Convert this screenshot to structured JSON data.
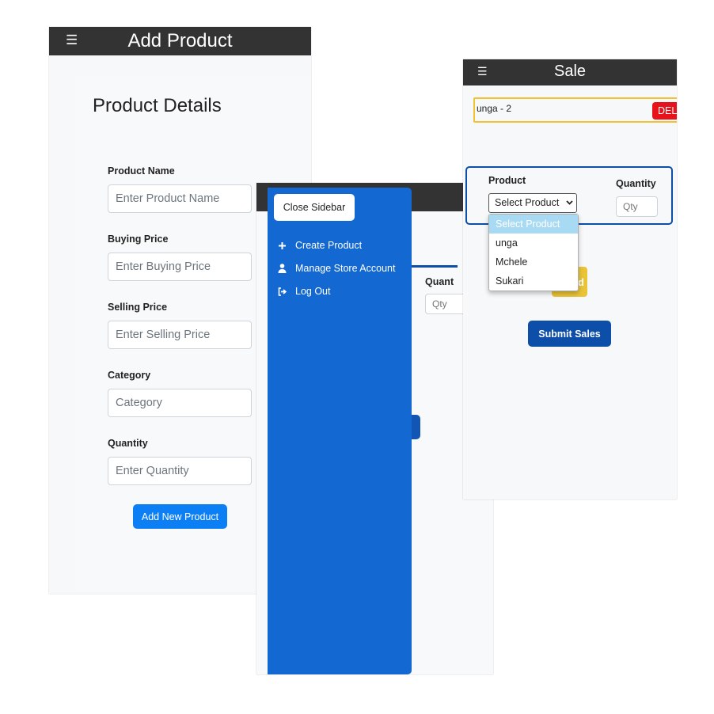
{
  "add_product": {
    "title": "Add Product",
    "menu_icon": "☰",
    "heading": "Product Details",
    "fields": [
      {
        "label": "Product Name",
        "placeholder": "Enter Product Name"
      },
      {
        "label": "Buying Price",
        "placeholder": "Enter Buying Price"
      },
      {
        "label": "Selling Price",
        "placeholder": "Enter Selling Price"
      },
      {
        "label": "Category",
        "placeholder": "Category"
      },
      {
        "label": "Quantity",
        "placeholder": "Enter Quantity"
      }
    ],
    "submit_label": "Add New Product"
  },
  "sidebar_screen": {
    "close_label": "Close Sidebar",
    "items": [
      {
        "label": "Create Product",
        "icon": "plus-icon"
      },
      {
        "label": "Manage Store Account",
        "icon": "user-icon"
      },
      {
        "label": "Log Out",
        "icon": "logout-icon"
      }
    ],
    "quantity_label": "Quant",
    "qty_placeholder": "Qty"
  },
  "sale": {
    "title": "Sale",
    "menu_icon": "☰",
    "cart_item": "unga - 2",
    "delete_label": "DEL",
    "product_label": "Product",
    "quantity_label": "Quantity",
    "select_value": "Select Product",
    "qty_placeholder": "Qty",
    "options": [
      "Select Product",
      "unga",
      "Mchele",
      "Sukari"
    ],
    "add_label": "d",
    "submit_label": "Submit Sales"
  },
  "colors": {
    "header": "#333333",
    "primary": "#0d7ff5",
    "sidebar": "#1368d1",
    "dark_blue": "#0c4ea8",
    "delete": "#e8131a",
    "warning": "#e9c437",
    "highlight": "#a8dbf3"
  }
}
